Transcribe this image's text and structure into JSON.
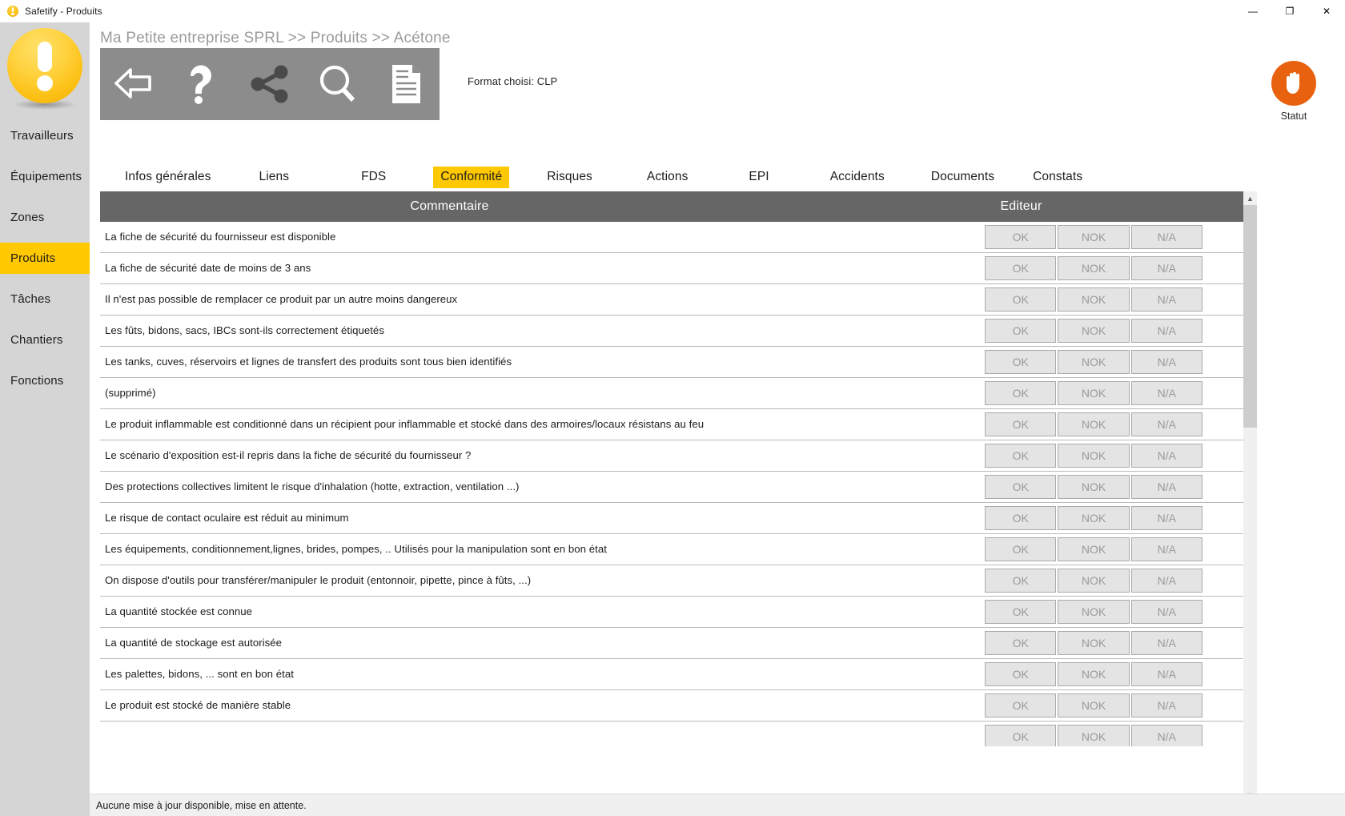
{
  "window": {
    "title": "Safetify - Produits",
    "app_icon": "safetify-logo-icon",
    "controls": {
      "minimize": "—",
      "restore": "❐",
      "close": "✕"
    }
  },
  "sidebar": {
    "items": [
      {
        "label": "Travailleurs",
        "active": false
      },
      {
        "label": "Équipements",
        "active": false
      },
      {
        "label": "Zones",
        "active": false
      },
      {
        "label": "Produits",
        "active": true
      },
      {
        "label": "Tâches",
        "active": false
      },
      {
        "label": "Chantiers",
        "active": false
      },
      {
        "label": "Fonctions",
        "active": false
      }
    ]
  },
  "header": {
    "breadcrumb": "Ma Petite entreprise SPRL >> Produits >> Acétone",
    "format_choice": "Format choisi: CLP",
    "toolbar_buttons": [
      {
        "icon": "back-arrow-icon",
        "name": "back-button"
      },
      {
        "icon": "help-question-icon",
        "name": "help-button"
      },
      {
        "icon": "share-icon",
        "name": "share-button"
      },
      {
        "icon": "search-magnifier-icon",
        "name": "search-button"
      },
      {
        "icon": "document-icon",
        "name": "document-button"
      }
    ],
    "statut": {
      "label": "Statut",
      "icon": "stop-hand-icon",
      "color": "#e8610f"
    }
  },
  "tabs": [
    {
      "label": "Infos générales",
      "active": false
    },
    {
      "label": "Liens",
      "active": false
    },
    {
      "label": "FDS",
      "active": false
    },
    {
      "label": "Conformité",
      "active": true
    },
    {
      "label": "Risques",
      "active": false
    },
    {
      "label": "Actions",
      "active": false
    },
    {
      "label": "EPI",
      "active": false
    },
    {
      "label": "Accidents",
      "active": false
    },
    {
      "label": "Documents",
      "active": false
    },
    {
      "label": "Constats",
      "active": false
    }
  ],
  "table": {
    "columns": [
      "Commentaire",
      "Editeur"
    ],
    "button_labels": [
      "OK",
      "NOK",
      "N/A"
    ],
    "rows": [
      {
        "label": "La fiche de sécurité du fournisseur est disponible"
      },
      {
        "label": "La fiche de sécurité date de moins de 3 ans"
      },
      {
        "label": "Il n'est pas possible de remplacer ce produit par un autre moins dangereux"
      },
      {
        "label": "Les fûts, bidons, sacs, IBCs sont-ils correctement étiquetés"
      },
      {
        "label": "Les tanks, cuves, réservoirs et lignes de transfert des produits sont tous bien identifiés"
      },
      {
        "label": "(supprimé)"
      },
      {
        "label": "Le produit inflammable est conditionné dans un récipient pour inflammable et stocké dans des armoires/locaux résistans au feu"
      },
      {
        "label": "Le scénario d'exposition est-il repris dans la fiche de sécurité du fournisseur ?"
      },
      {
        "label": "Des protections collectives limitent le risque d'inhalation (hotte, extraction, ventilation ...)"
      },
      {
        "label": "Le risque de contact oculaire est réduit au minimum"
      },
      {
        "label": "Les équipements, conditionnement,lignes, brides, pompes, .. Utilisés pour la manipulation sont en bon état"
      },
      {
        "label": "On dispose d'outils pour transférer/manipuler le produit (entonnoir, pipette, pince à fûts, ...)"
      },
      {
        "label": "La quantité stockée est connue"
      },
      {
        "label": "La quantité de stockage est autorisée"
      },
      {
        "label": "Les palettes, bidons, ... sont en bon état"
      },
      {
        "label": "Le produit est stocké de manière stable"
      },
      {
        "label": ""
      }
    ]
  },
  "scrollbar": {
    "up_arrow": "▲",
    "down_arrow": "▼"
  },
  "statusbar": {
    "message": "Aucune mise à jour disponible, mise en attente."
  },
  "colors": {
    "accent_yellow": "#ffc800",
    "toolbar_gray": "#8c8c8c",
    "header_gray": "#666666",
    "statut_orange": "#e8610f"
  }
}
